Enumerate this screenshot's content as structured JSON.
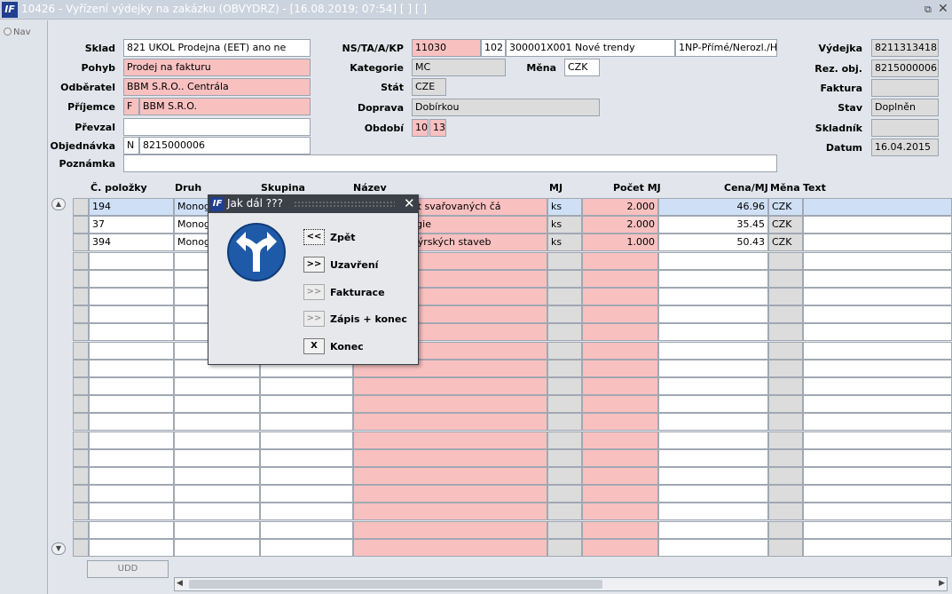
{
  "window": {
    "logo": "IF",
    "title": "10426 - Vyřízení výdejky na zakázku (OBVYDRZ) - [16.08.2019; 07:54]  [ ]  [ ]"
  },
  "nav": {
    "label": "Nav"
  },
  "form": {
    "sklad": {
      "label": "Sklad",
      "value": "821 UKOL Prodejna (EET) ano ne"
    },
    "pohyb": {
      "label": "Pohyb",
      "value": "Prodej na fakturu"
    },
    "odberatel": {
      "label": "Odběratel",
      "value": "BBM S.R.O.. Centrála"
    },
    "prijemce": {
      "label": "Příjemce",
      "code": "F",
      "value": "BBM S.R.O."
    },
    "prevzal": {
      "label": "Převzal",
      "value": ""
    },
    "objednavka": {
      "label": "Objednávka",
      "code": "N",
      "value": "8215000006"
    },
    "poznamka": {
      "label": "Poznámka",
      "value": ""
    },
    "ns": {
      "label": "NS/TA/A/KP",
      "value1": "11030",
      "value2": "102",
      "value3": "300001X001 Nové trendy",
      "value4": "1NP-Přímé/Nerozl./HČ-I"
    },
    "kategorie": {
      "label": "Kategorie",
      "value": "MC"
    },
    "mena": {
      "label": "Měna",
      "value": "CZK"
    },
    "stat": {
      "label": "Stát",
      "value": "CZE"
    },
    "doprava": {
      "label": "Doprava",
      "value": "Dobírkou"
    },
    "obdobi": {
      "label": "Období",
      "value1": "10",
      "value2": "13"
    },
    "vydejka": {
      "label": "Výdejka",
      "value": "8211313418"
    },
    "rezobj": {
      "label": "Rez. obj.",
      "value": "8215000006"
    },
    "faktura": {
      "label": "Faktura",
      "value": ""
    },
    "stav": {
      "label": "Stav",
      "value": "Doplněn"
    },
    "skladnik": {
      "label": "Skladník",
      "value": ""
    },
    "datum": {
      "label": "Datum",
      "value": "16.04.2015"
    }
  },
  "table": {
    "headers": {
      "cpolozky": "Č. položky",
      "druh": "Druh",
      "skupina": "Skupina",
      "nazev": "Název",
      "mj": "MJ",
      "pocet": "Počet MJ",
      "cena": "Cena/MJ",
      "mena": "Měna",
      "text": "Text"
    },
    "rows": [
      {
        "cpolozky": "194",
        "druh": "Monog",
        "skupina": "",
        "nazev": "livá životnost svařovaných čá",
        "mj": "ks",
        "pocet": "2.000",
        "cena": "46.96",
        "mena": "CZK",
        "text": ""
      },
      {
        "cpolozky": "37",
        "druh": "Monog",
        "skupina": "",
        "nazev": "ční technologie",
        "mj": "ks",
        "pocet": "2.000",
        "cena": "35.45",
        "mena": "CZK",
        "text": ""
      },
      {
        "cpolozky": "394",
        "druh": "Monog",
        "skupina": "",
        "nazev": "ektura inženýrských staveb",
        "mj": "ks",
        "pocet": "1.000",
        "cena": "50.43",
        "mena": "CZK",
        "text": ""
      }
    ],
    "empty_rows": 17
  },
  "footer": {
    "udd_label": "UDD"
  },
  "dialog": {
    "logo": "IF",
    "title": "Jak dál ???",
    "icon": "turn-left-or-right-sign-icon",
    "buttons": [
      {
        "icon": "<<",
        "label": "Zpět"
      },
      {
        "icon": ">>",
        "label": "Uzavření"
      },
      {
        "icon": ">>",
        "label": "Fakturace"
      },
      {
        "icon": ">>",
        "label": "Zápis + konec"
      },
      {
        "icon": "X",
        "label": "Konec"
      }
    ]
  },
  "colors": {
    "required": "#f9c0c0",
    "readonly": "#dcdcdc",
    "selected": "#cfe0f6",
    "sign_blue": "#1f5aa8"
  }
}
